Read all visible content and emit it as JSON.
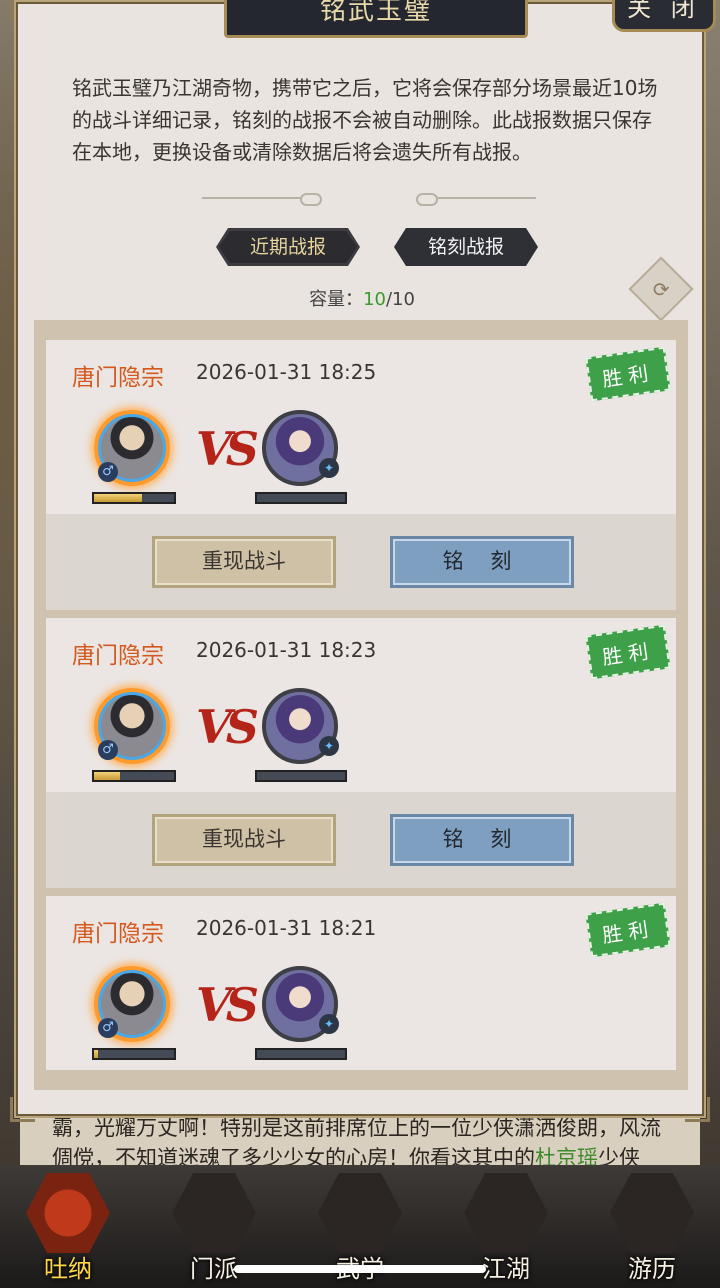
{
  "panel": {
    "title": "铭武玉璧",
    "close_label": "关 闭",
    "description": "铭武玉璧乃江湖奇物，携带它之后，它将会保存部分场景最近10场的战斗详细记录，铭刻的战报不会被自动删除。此战报数据只保存在本地，更换设备或清除数据后将会遗失所有战报。",
    "tabs": {
      "recent": "近期战报",
      "engraved": "铭刻战报"
    },
    "capacity_label": "容量：",
    "capacity_current": "10",
    "capacity_max": "/10",
    "refresh_icon": "⟳"
  },
  "battles": [
    {
      "sect": "唐门隐宗",
      "time": "2026-01-31 18:25",
      "result": "胜利",
      "my_health": 0.6,
      "foe_health": 0,
      "replay": "重现战斗",
      "engrave": "铭 刻"
    },
    {
      "sect": "唐门隐宗",
      "time": "2026-01-31 18:23",
      "result": "胜利",
      "my_health": 0.33,
      "foe_health": 0,
      "replay": "重现战斗",
      "engrave": "铭 刻"
    },
    {
      "sect": "唐门隐宗",
      "time": "2026-01-31 18:21",
      "result": "胜利",
      "my_health": 0.05,
      "foe_health": 0
    }
  ],
  "vs_label": "VS",
  "gender_icon": "♂",
  "story": {
    "line1": "霸，光耀万丈啊！特别是这前排席位上的一位少侠潇洒俊朗，风流",
    "line2_a": "倜傥，不知道迷魂了多少少女的心房！你看这其中的",
    "line2_hl": "杜京瑶",
    "line2_b": "少侠"
  },
  "nav": [
    {
      "label": "吐纳",
      "active": true
    },
    {
      "label": "门派",
      "active": false
    },
    {
      "label": "武学",
      "active": false
    },
    {
      "label": "江湖",
      "active": false
    },
    {
      "label": "游历",
      "active": false
    }
  ]
}
